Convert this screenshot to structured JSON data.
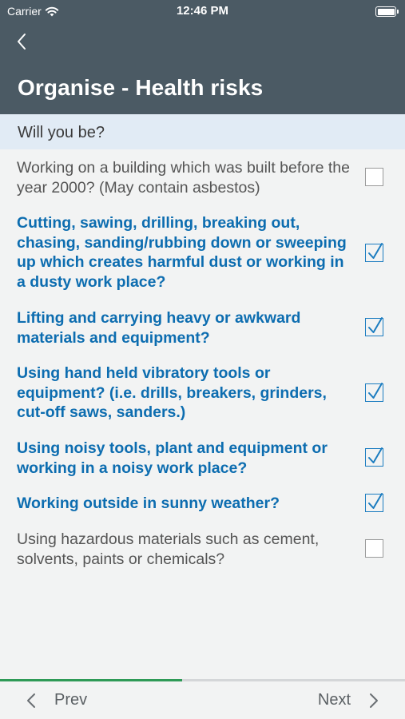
{
  "status_bar": {
    "carrier": "Carrier",
    "time": "12:46 PM"
  },
  "header": {
    "title": "Organise - Health risks"
  },
  "section": {
    "label": "Will you be?"
  },
  "questions": [
    {
      "text": "Working on a building which was built before the year 2000? (May contain asbestos)",
      "checked": false
    },
    {
      "text": "Cutting, sawing, drilling, breaking out, chasing, sanding/rubbing down or sweeping up which creates harmful dust or working in a dusty work place?",
      "checked": true
    },
    {
      "text": "Lifting and carrying heavy or awkward materials and equipment?",
      "checked": true
    },
    {
      "text": "Using hand held vibratory tools or equipment? (i.e. drills, breakers, grinders, cut-off saws, sanders.)",
      "checked": true
    },
    {
      "text": "Using noisy tools, plant and equipment or working in a noisy work place?",
      "checked": true
    },
    {
      "text": "Working outside in sunny weather?",
      "checked": true
    },
    {
      "text": "Using hazardous materials such as cement, solvents, paints or chemicals?",
      "checked": false
    }
  ],
  "progress": {
    "fraction": 0.45
  },
  "footer": {
    "prev_label": "Prev",
    "next_label": "Next"
  },
  "colors": {
    "header": "#4b5a64",
    "accent": "#0d6db0",
    "section_bg": "#e1ebf5",
    "progress": "#2e9a56"
  },
  "icons": {
    "back": "chevron-left-icon",
    "prev": "chevron-left-icon",
    "next": "chevron-right-icon",
    "checkbox_checked": "checkmark-icon",
    "wifi": "wifi-icon",
    "battery": "battery-icon"
  }
}
